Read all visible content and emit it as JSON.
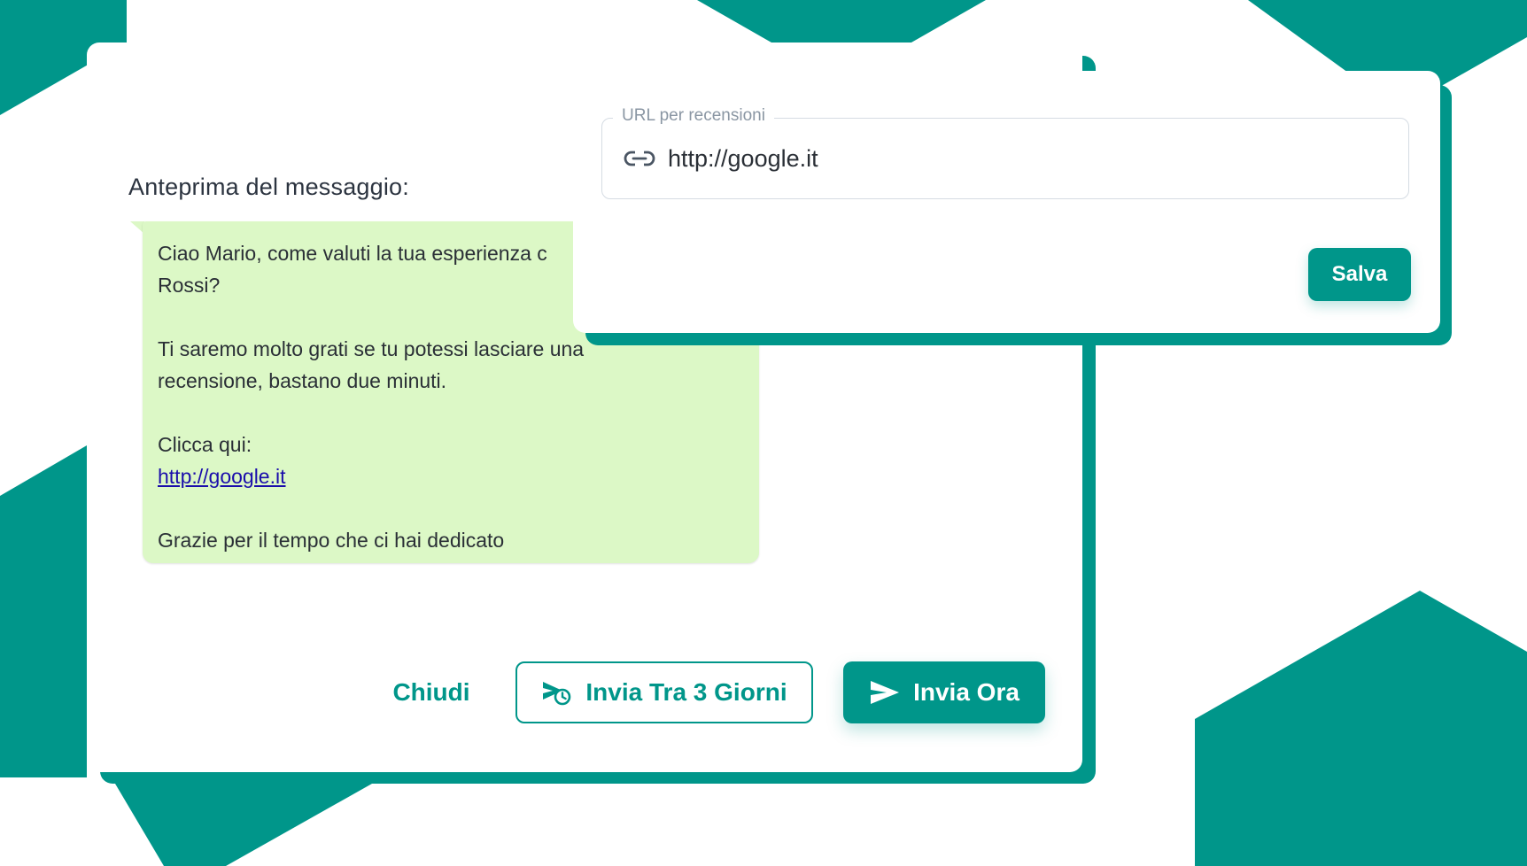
{
  "colors": {
    "accent": "#00968a",
    "bubble": "#dcf8c6",
    "link": "#1a0dab",
    "text": "#2a2f36"
  },
  "message_card": {
    "preview_title": "Anteprima del messaggio:",
    "message": {
      "greeting_line1": "Ciao Mario, come valuti la tua esperienza c",
      "greeting_line2": "Rossi?",
      "body_line1": "Ti saremo molto grati se tu potessi lasciare una",
      "body_line2": "recensione, bastano due minuti.",
      "cta": "Clicca qui:",
      "link": "http://google.it",
      "closing": "Grazie per il tempo che ci hai dedicato"
    },
    "actions": {
      "close_label": "Chiudi",
      "schedule_label": "Invia Tra 3 Giorni",
      "schedule_icon": "scheduled-send-icon",
      "send_label": "Invia Ora",
      "send_icon": "send-icon"
    }
  },
  "url_card": {
    "field_label": "URL per recensioni",
    "field_icon": "link-icon",
    "field_value": "http://google.it",
    "save_label": "Salva"
  }
}
